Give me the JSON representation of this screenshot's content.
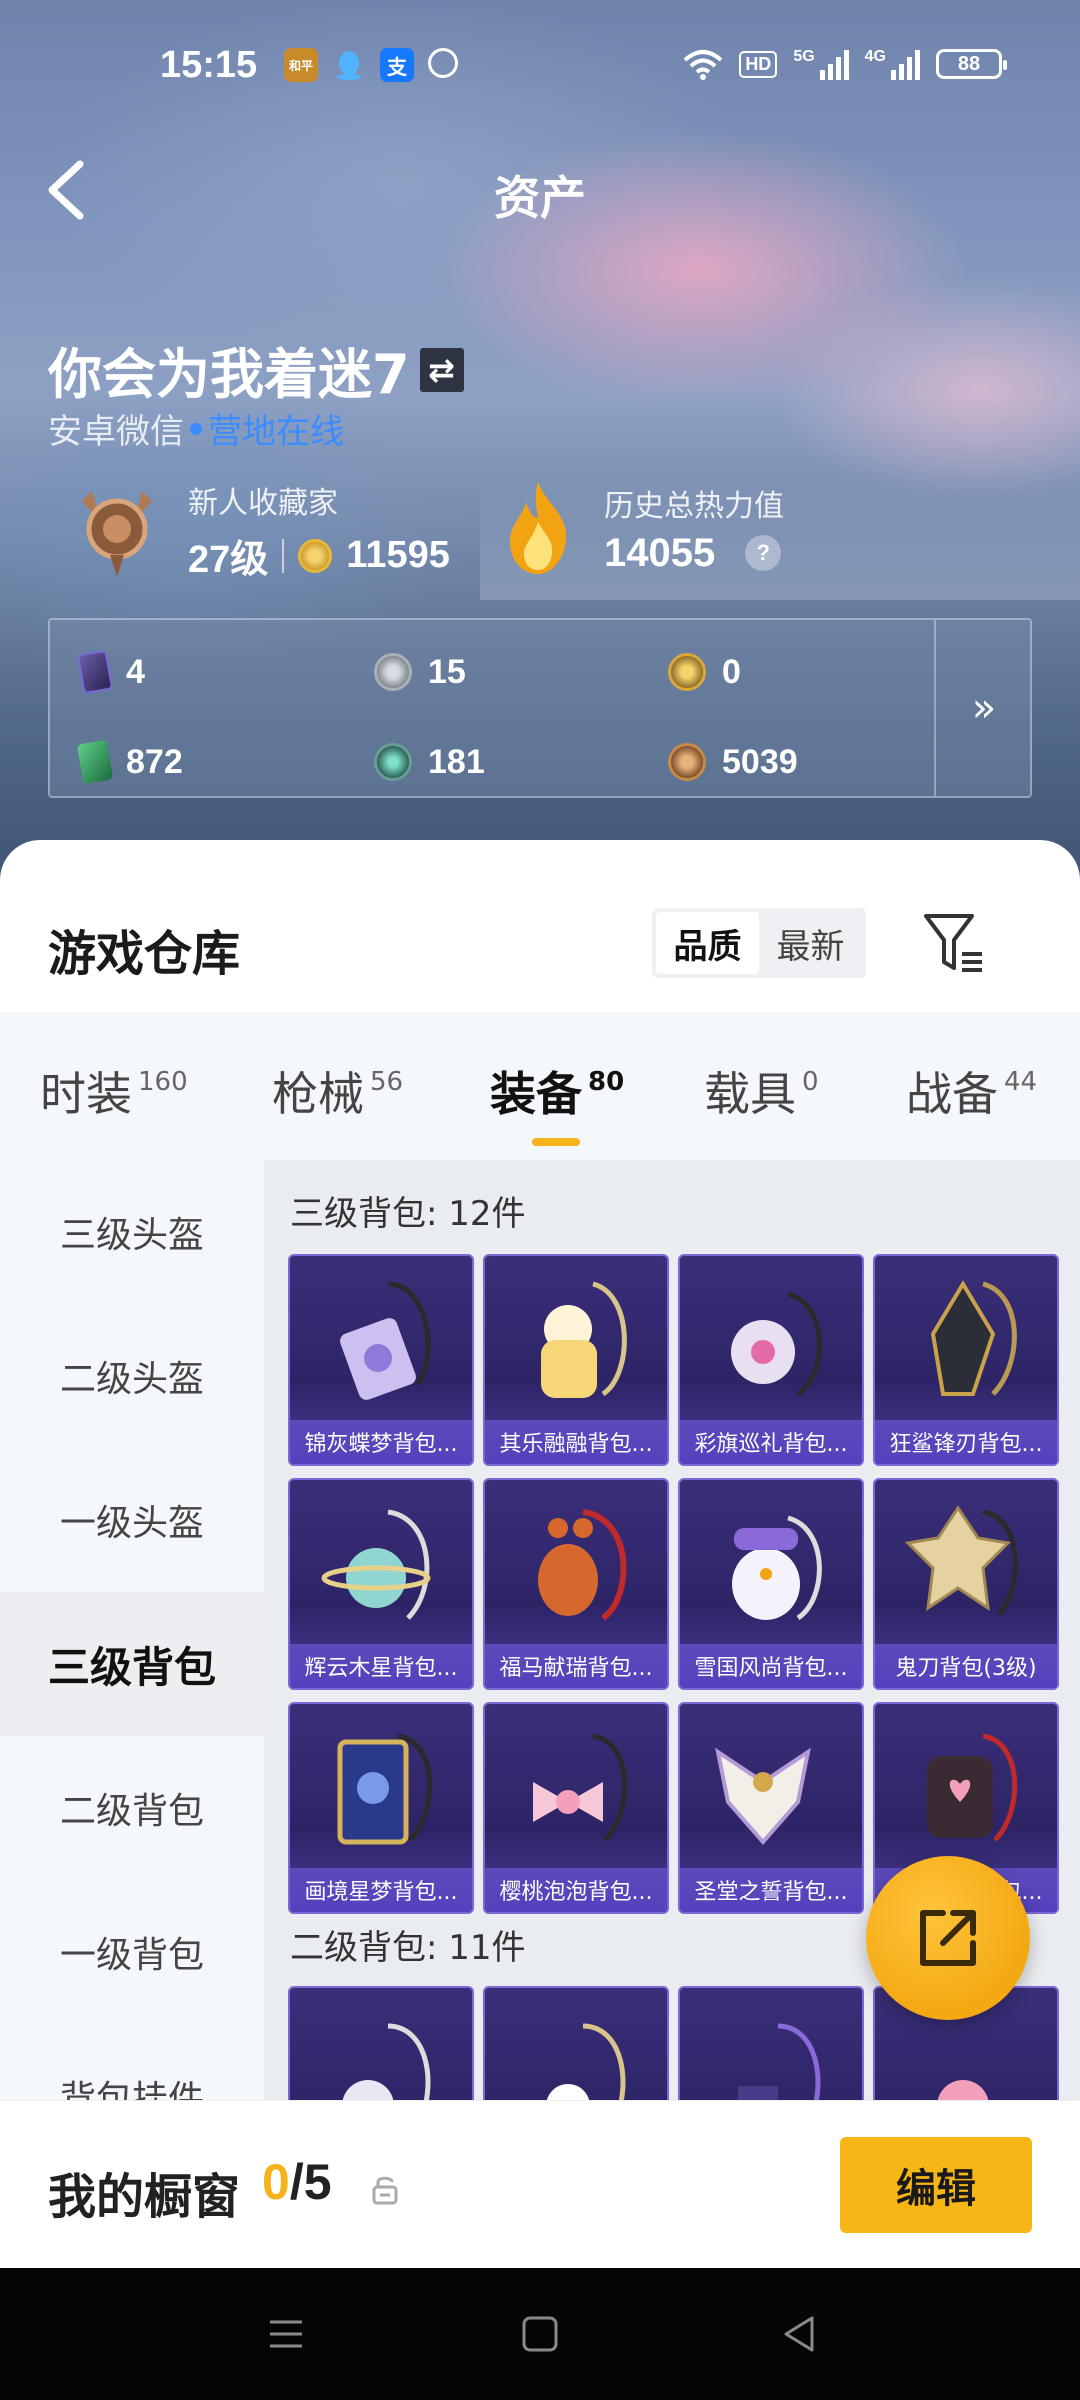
{
  "status_bar": {
    "time": "15:15",
    "hd_label": "HD",
    "net1": "5G",
    "net2": "4G",
    "battery": "88",
    "app_icons": [
      "game-app-icon",
      "qq-icon",
      "alipay-icon",
      "chat-icon"
    ],
    "alipay_glyph": "支",
    "game_glyph": "和平"
  },
  "header": {
    "title": "资产",
    "back_icon": "chevron-left-icon"
  },
  "profile": {
    "username": "你会为我着迷7",
    "swap_glyph": "⇄",
    "platform": "安卓微信",
    "online_status": "营地在线",
    "collector_title": "新人收藏家",
    "collector_level": "27级",
    "collector_points": "11595",
    "heat_title": "历史总热力值",
    "heat_value": "14055",
    "help_glyph": "?"
  },
  "currencies": [
    {
      "icon": "purple-card-icon",
      "value": "4"
    },
    {
      "icon": "silver-coin-icon",
      "value": "15"
    },
    {
      "icon": "gold-coin-icon",
      "value": "0"
    },
    {
      "icon": "green-card-icon",
      "value": "872"
    },
    {
      "icon": "green-coin-icon",
      "value": "181"
    },
    {
      "icon": "bronze-coin-icon",
      "value": "5039"
    }
  ],
  "currency_more_glyph": "»",
  "warehouse": {
    "title": "游戏仓库",
    "sort_options": [
      "品质",
      "最新"
    ],
    "active_sort": "品质"
  },
  "tabs": [
    {
      "label": "时装",
      "count": "160"
    },
    {
      "label": "枪械",
      "count": "56"
    },
    {
      "label": "装备",
      "count": "80"
    },
    {
      "label": "载具",
      "count": "0"
    },
    {
      "label": "战备",
      "count": "44"
    }
  ],
  "active_tab": "装备",
  "sidebar": [
    "三级头盔",
    "二级头盔",
    "一级头盔",
    "三级背包",
    "二级背包",
    "一级背包",
    "背包挂件"
  ],
  "active_sidebar": "三级背包",
  "sections": [
    {
      "title": "三级背包: 12件",
      "items": [
        "锦灰蝶梦背包...",
        "其乐融融背包...",
        "彩旗巡礼背包...",
        "狂鲨锋刃背包...",
        "辉云木星背包...",
        "福马献瑞背包...",
        "雪国风尚背包...",
        "鬼刀背包(3级)",
        "画境星梦背包...",
        "樱桃泡泡背包...",
        "圣堂之誓背包...",
        "桃心甜点背包..."
      ]
    },
    {
      "title": "二级背包: 11件",
      "items": [
        "",
        "",
        "",
        ""
      ]
    }
  ],
  "showcase": {
    "label": "我的橱窗",
    "current": "0",
    "total": "/5",
    "edit_label": "编辑"
  }
}
